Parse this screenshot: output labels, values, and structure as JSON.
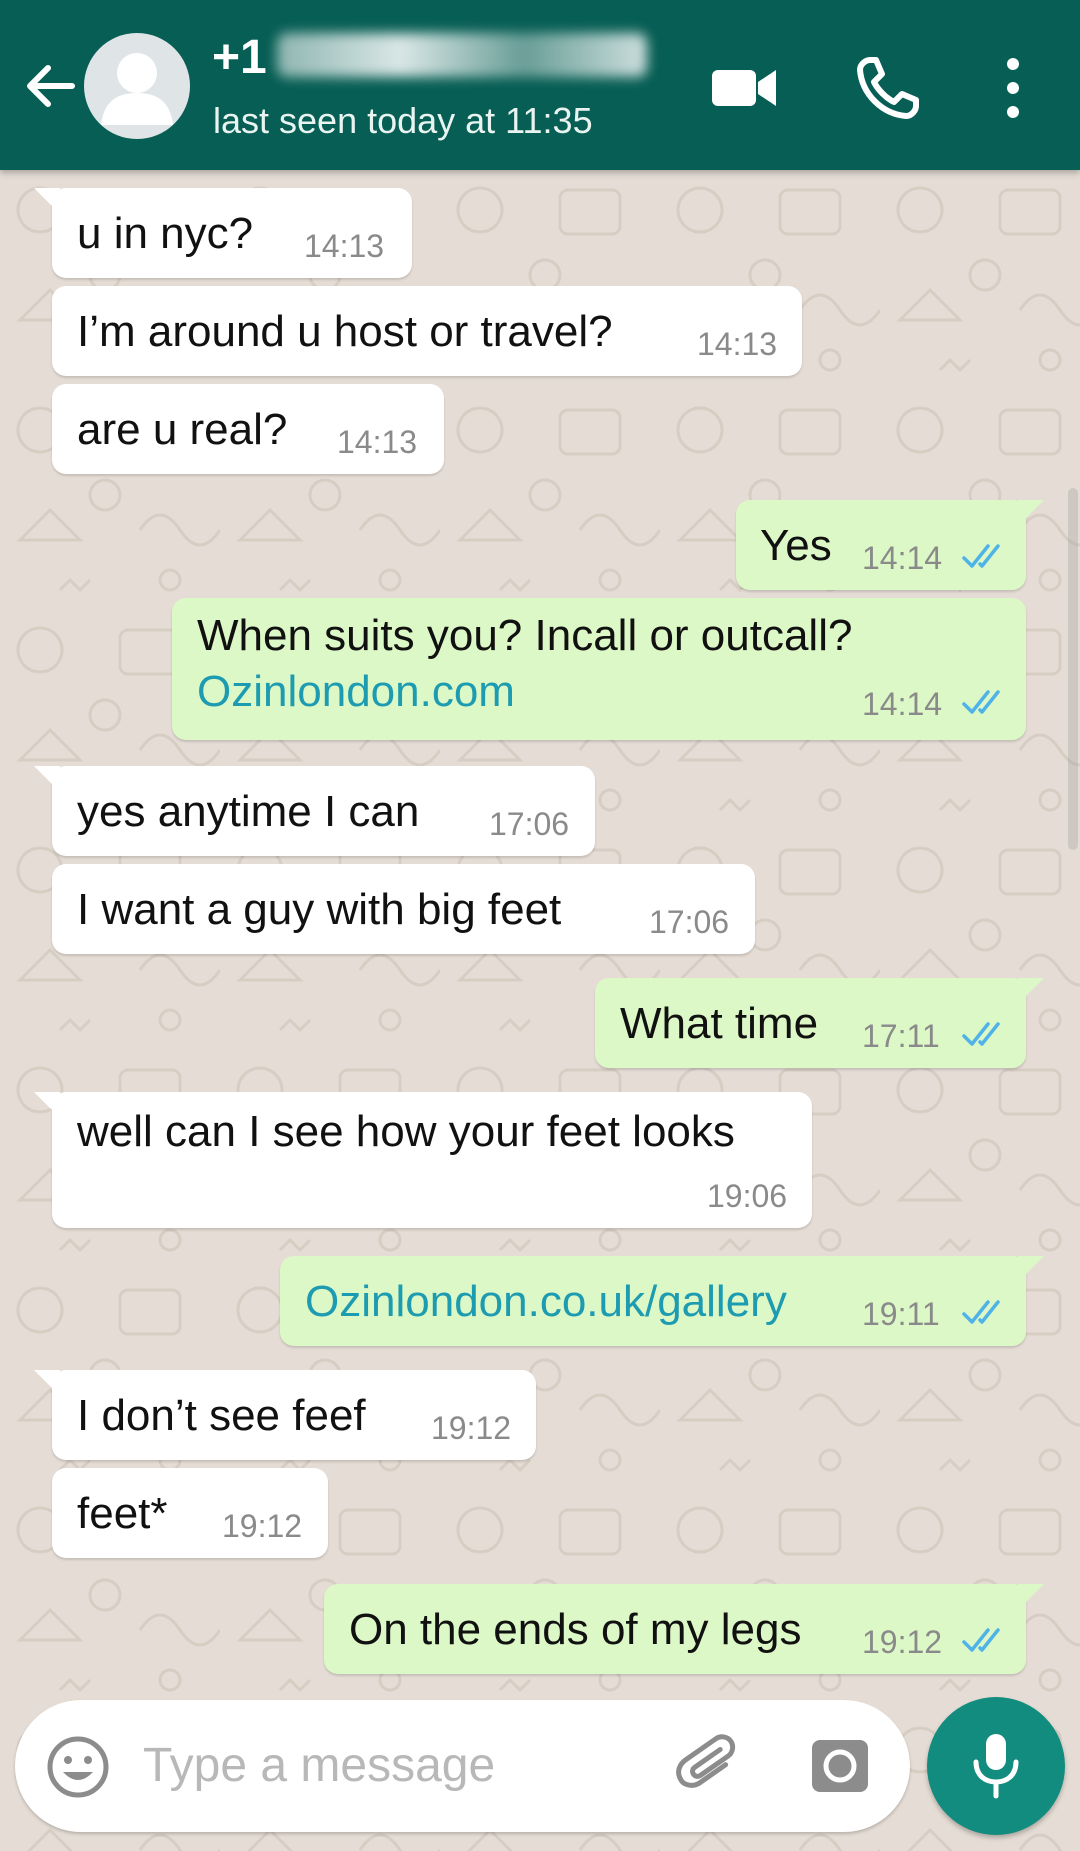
{
  "header": {
    "contact_name_visible": "+1",
    "status": "last seen today at 11:35",
    "icons": [
      "back-arrow-icon",
      "avatar-icon",
      "video-call-icon",
      "phone-call-icon",
      "more-vert-icon"
    ],
    "color": "#075e54"
  },
  "messages": [
    {
      "direction": "in",
      "text": "u in nyc?",
      "time": "14:13"
    },
    {
      "direction": "in",
      "text": "I’m around u host or travel?",
      "time": "14:13"
    },
    {
      "direction": "in",
      "text": "are u real?",
      "time": "14:13"
    },
    {
      "direction": "out",
      "text": "Yes",
      "time": "14:14",
      "status": "read"
    },
    {
      "direction": "out",
      "text": "When suits you? Incall or outcall?",
      "link": "Ozinlondon.com",
      "time": "14:14",
      "status": "read"
    },
    {
      "direction": "in",
      "text": "yes anytime I can",
      "time": "17:06"
    },
    {
      "direction": "in",
      "text": "I want a guy with big feet",
      "time": "17:06"
    },
    {
      "direction": "out",
      "text": "What time",
      "time": "17:11",
      "status": "read"
    },
    {
      "direction": "in",
      "text": "well can I see how your feet looks",
      "time": "19:06"
    },
    {
      "direction": "out",
      "link": "Ozinlondon.co.uk/gallery",
      "time": "19:11",
      "status": "read"
    },
    {
      "direction": "in",
      "text": "I don’t see feef",
      "time": "19:12"
    },
    {
      "direction": "in",
      "text": "feet*",
      "time": "19:12"
    },
    {
      "direction": "out",
      "text": "On the ends of my legs",
      "time": "19:12",
      "status": "read"
    }
  ],
  "composer": {
    "placeholder": "Type a message",
    "icons": [
      "emoji-icon",
      "attach-icon",
      "camera-icon",
      "mic-icon"
    ]
  },
  "colors": {
    "incoming_bubble": "#ffffff",
    "outgoing_bubble": "#dcf8c6",
    "link": "#1d9bb0",
    "read_ticks": "#4fb3e8",
    "mic_button": "#128c7e",
    "wallpaper": "#e5ddd5"
  }
}
